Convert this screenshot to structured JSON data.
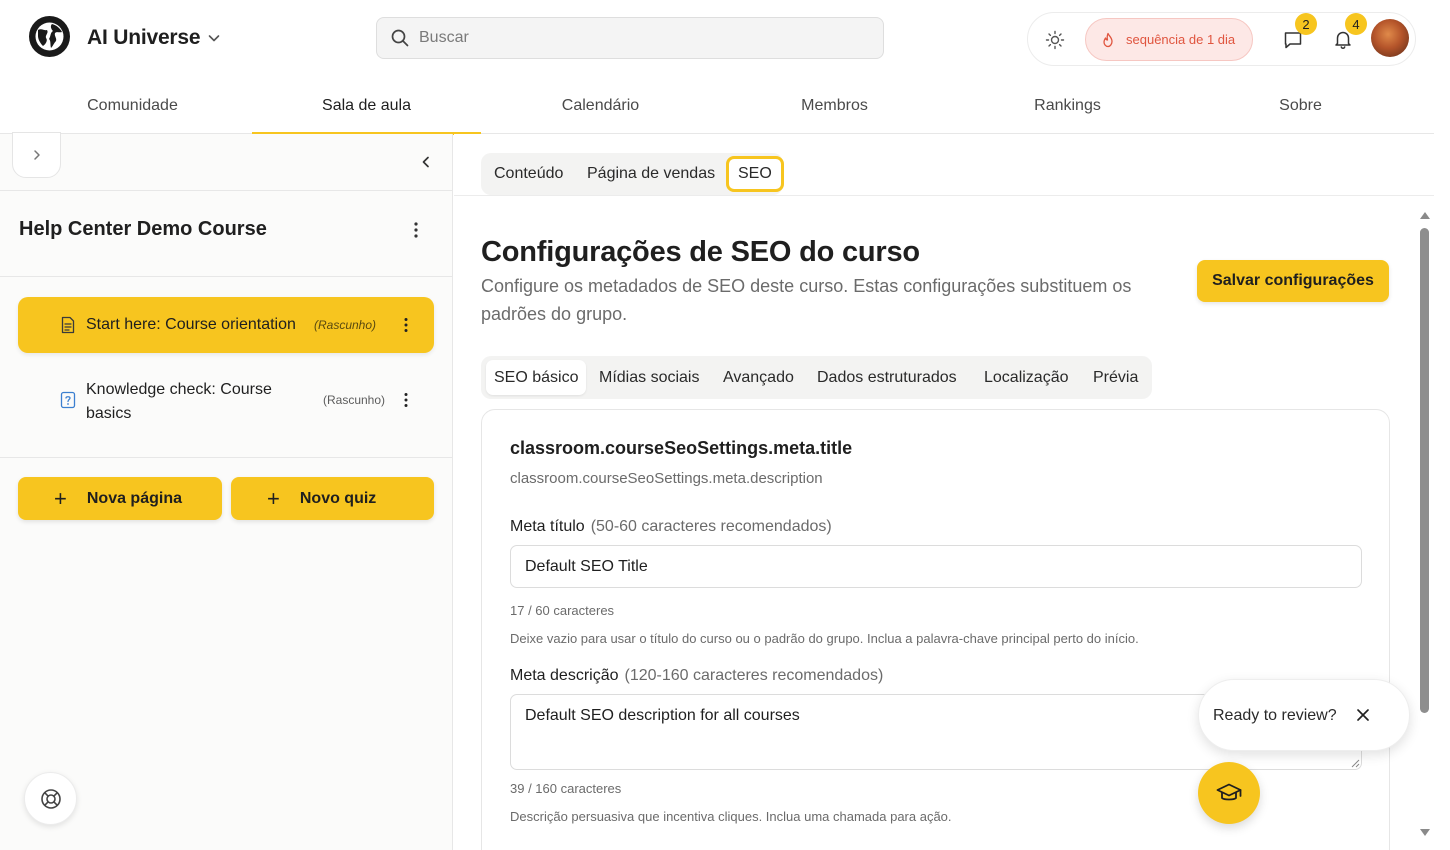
{
  "app": {
    "name": "AI Universe",
    "logo_icon": "globe-logo-icon",
    "accent_color": "#f7c51f"
  },
  "search": {
    "placeholder": "Buscar",
    "value": ""
  },
  "header_actions": {
    "streak_label": "sequência de 1 dia",
    "messages_count": "2",
    "notifications_count": "4"
  },
  "nav": {
    "tabs": [
      {
        "label": "Comunidade",
        "active": false
      },
      {
        "label": "Sala de aula",
        "active": true
      },
      {
        "label": "Calendário",
        "active": false
      },
      {
        "label": "Membros",
        "active": false
      },
      {
        "label": "Rankings",
        "active": false
      },
      {
        "label": "Sobre",
        "active": false
      }
    ]
  },
  "sidebar": {
    "course_title": "Help Center Demo Course",
    "lessons": [
      {
        "title": "Start here: Course orientation",
        "status": "(Rascunho)",
        "icon": "document-icon",
        "active": true
      },
      {
        "title": "Knowledge check: Course basics",
        "status": "(Rascunho)",
        "icon": "quiz-icon",
        "active": false
      }
    ],
    "new_page_label": "Nova página",
    "new_quiz_label": "Novo quiz"
  },
  "content_tabs": [
    {
      "label": "Conteúdo",
      "active": false
    },
    {
      "label": "Página de vendas",
      "active": false
    },
    {
      "label": "SEO",
      "active": true
    }
  ],
  "seo": {
    "title": "Configurações de SEO do curso",
    "subtitle": "Configure os metadados de SEO deste curso. Estas configurações substituem os padrões do grupo.",
    "save_label": "Salvar configurações",
    "tabs": [
      {
        "label": "SEO básico",
        "active": true
      },
      {
        "label": "Mídias sociais",
        "active": false
      },
      {
        "label": "Avançado",
        "active": false
      },
      {
        "label": "Dados estruturados",
        "active": false
      },
      {
        "label": "Localização",
        "active": false
      },
      {
        "label": "Prévia",
        "active": false
      }
    ],
    "card": {
      "title": "classroom.courseSeoSettings.meta.title",
      "description": "classroom.courseSeoSettings.meta.description",
      "meta_title": {
        "label": "Meta título",
        "hint": "(50-60 caracteres recomendados)",
        "value": "Default SEO Title",
        "counter": "17 / 60 caracteres",
        "help": "Deixe vazio para usar o título do curso ou o padrão do grupo. Inclua a palavra-chave principal perto do início."
      },
      "meta_description": {
        "label": "Meta descrição",
        "hint": "(120-160 caracteres recomendados)",
        "value": "Default SEO description for all courses",
        "counter": "39 / 160 caracteres",
        "help": "Descrição persuasiva que incentiva cliques. Inclua uma chamada para ação."
      }
    }
  },
  "review_popup": {
    "text": "Ready to review?"
  }
}
